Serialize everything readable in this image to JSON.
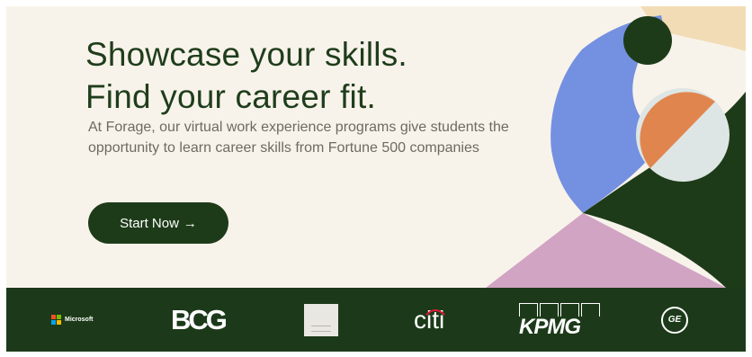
{
  "hero": {
    "headline_line1": "Showcase your skills.",
    "headline_line2": "Find your career fit.",
    "description": "At Forage, our virtual work experience programs give students the opportunity to learn career skills from Fortune 500 companies",
    "cta_label": "Start Now",
    "cta_icon": "arrow-right-icon",
    "cta_arrow": "→"
  },
  "logos": {
    "microsoft": "Microsoft",
    "bcg": "BCG",
    "bain": "",
    "citi": "citi",
    "kpmg": "KPMG",
    "ge": "GE"
  },
  "colors": {
    "background": "#f8f3ea",
    "dark_green": "#1e3b19",
    "headline": "#1f3d1c",
    "body_text": "#6e6a62",
    "blue": "#7490e0",
    "orange": "#e1854e",
    "pale_blue": "#dde6e4",
    "peach": "#f2dcb6",
    "pink": "#d1a4c4"
  }
}
